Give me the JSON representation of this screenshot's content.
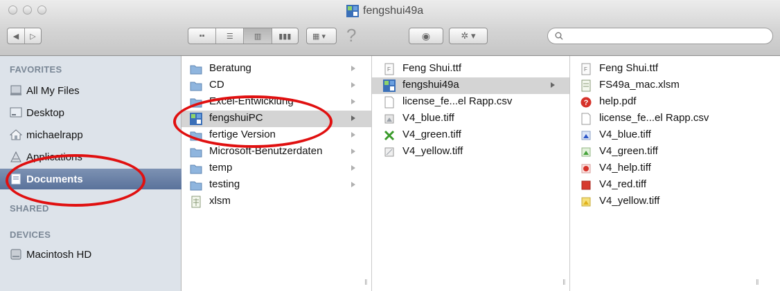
{
  "window": {
    "title": "fengshui49a"
  },
  "toolbar": {
    "search_placeholder": "",
    "help_glyph": "?"
  },
  "sidebar": {
    "favorites_header": "FAVORITES",
    "shared_header": "SHARED",
    "devices_header": "DEVICES",
    "favorites": [
      {
        "label": "All My Files",
        "icon": "all-files-icon"
      },
      {
        "label": "Desktop",
        "icon": "desktop-icon"
      },
      {
        "label": "michaelrapp",
        "icon": "home-icon"
      },
      {
        "label": "Applications",
        "icon": "applications-icon"
      },
      {
        "label": "Documents",
        "icon": "documents-icon",
        "selected": true
      }
    ],
    "devices": [
      {
        "label": "Macintosh HD",
        "icon": "harddisk-icon"
      }
    ]
  },
  "columns": [
    {
      "items": [
        {
          "label": "Beratung",
          "type": "folder",
          "arrow": true
        },
        {
          "label": "CD",
          "type": "folder",
          "arrow": true
        },
        {
          "label": "Excel-Entwicklung",
          "type": "folder",
          "arrow": true
        },
        {
          "label": "fengshuiPC",
          "type": "app-folder",
          "arrow": true,
          "selected": true
        },
        {
          "label": "fertige Version",
          "type": "folder",
          "arrow": true
        },
        {
          "label": "Microsoft-Benutzerdaten",
          "type": "folder",
          "arrow": true
        },
        {
          "label": "temp",
          "type": "folder",
          "arrow": true
        },
        {
          "label": "testing",
          "type": "folder",
          "arrow": true
        },
        {
          "label": "xlsm",
          "type": "file",
          "arrow": false
        }
      ]
    },
    {
      "items": [
        {
          "label": "Feng Shui.ttf",
          "type": "font"
        },
        {
          "label": "fengshui49a",
          "type": "app-folder",
          "arrow": true,
          "selected": true
        },
        {
          "label": "license_fe...el Rapp.csv",
          "type": "file"
        },
        {
          "label": "V4_blue.tiff",
          "type": "image"
        },
        {
          "label": "V4_green.tiff",
          "type": "green-x"
        },
        {
          "label": "V4_yellow.tiff",
          "type": "image"
        }
      ]
    },
    {
      "items": [
        {
          "label": "Feng Shui.ttf",
          "type": "font"
        },
        {
          "label": "FS49a_mac.xlsm",
          "type": "file"
        },
        {
          "label": "help.pdf",
          "type": "help"
        },
        {
          "label": "license_fe...el Rapp.csv",
          "type": "file"
        },
        {
          "label": "V4_blue.tiff",
          "type": "tiff-blue"
        },
        {
          "label": "V4_green.tiff",
          "type": "tiff-green"
        },
        {
          "label": "V4_help.tiff",
          "type": "tiff-help"
        },
        {
          "label": "V4_red.tiff",
          "type": "tiff-red"
        },
        {
          "label": "V4_yellow.tiff",
          "type": "tiff-yellow"
        }
      ]
    }
  ],
  "colors": {
    "selection": "#d4d4d4",
    "sidebar_selection": "#5a729b",
    "annotation_ring": "#e01010"
  }
}
